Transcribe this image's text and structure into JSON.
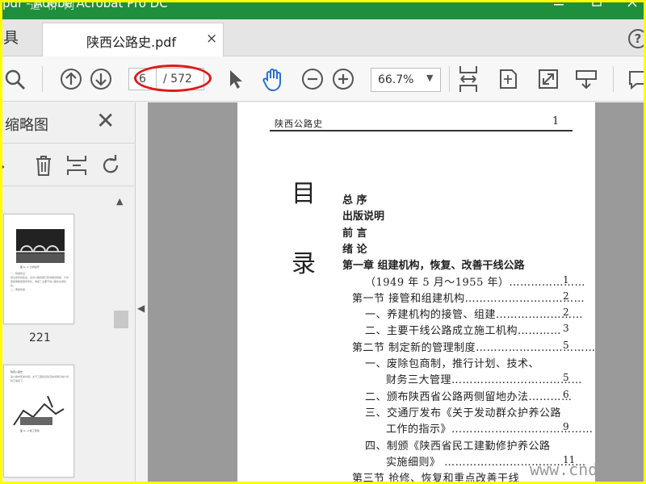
{
  "window": {
    "title": "pdf - Adobe Acrobat Pro DC",
    "watermark_top": "道 桥 网"
  },
  "tabs": {
    "tools_label": "具",
    "doc_name": "陕西公路史.pdf",
    "close": "×",
    "help": "?"
  },
  "toolbar": {
    "current_page": "6",
    "total_pages": "/ 572",
    "zoom": "66.7%",
    "zoom_arrow": "▼"
  },
  "panel": {
    "title": "缩略图",
    "close": "✕",
    "scroll_up": "▲",
    "thumb1_label": "221",
    "thumb1_caption": "图 6—1 大桥远景",
    "thumb1_body": "一、桥梁建设\n经过多年的建设，全省公路桥梁已形成相当规模，大中型桥梁数量逐年增长，承担了主要干线公路的交通任务。\n二、典型桥梁",
    "thumb2_heading": "陕西公路史",
    "thumb2_body": "第六章中所述内容，关于工程建设情况的说明与统计资料汇编如下。",
    "thumb2_caption": "图 6—2 施工现场"
  },
  "page": {
    "running_head": "陕西公路史",
    "page_number": "1",
    "big_chars": [
      "目",
      "录"
    ],
    "toc": [
      {
        "text": "总    序",
        "bold": true,
        "indent": 0,
        "num": ""
      },
      {
        "text": "出版说明",
        "bold": true,
        "indent": 0,
        "num": ""
      },
      {
        "text": "前    言",
        "bold": true,
        "indent": 0,
        "num": ""
      },
      {
        "text": "绪    论",
        "bold": true,
        "indent": 0,
        "num": ""
      },
      {
        "text": "第一章   组建机构，恢复、改善干线公路",
        "bold": true,
        "indent": 0,
        "num": ""
      },
      {
        "text": "（1949 年 5 月～1955 年）…………………",
        "bold": false,
        "indent": 28,
        "num": "1"
      },
      {
        "text": "第一节   接管和组建机构……………………………",
        "bold": false,
        "indent": 12,
        "num": "2"
      },
      {
        "text": "一、养建机构的接管、组建……………………",
        "bold": false,
        "indent": 28,
        "num": "2"
      },
      {
        "text": "二、主要干线公路成立施工机构…………",
        "bold": false,
        "indent": 28,
        "num": "3"
      },
      {
        "text": "第二节   制定新的管理制度……………………………",
        "bold": false,
        "indent": 12,
        "num": "5"
      },
      {
        "text": "一、废除包商制，推行计划、技术、",
        "bold": false,
        "indent": 28,
        "num": ""
      },
      {
        "text": "财务三大管理………………………………",
        "bold": false,
        "indent": 54,
        "num": "5"
      },
      {
        "text": "二、颁布陕西省公路两侧留地办法…………",
        "bold": false,
        "indent": 28,
        "num": "6"
      },
      {
        "text": "三、交通厅发布《关于发动群众护养公路",
        "bold": false,
        "indent": 28,
        "num": ""
      },
      {
        "text": "工作的指示》…………………………………",
        "bold": false,
        "indent": 54,
        "num": "9"
      },
      {
        "text": "四、制颁《陕西省民工建勤修护养公路",
        "bold": false,
        "indent": 28,
        "num": ""
      },
      {
        "text": "实施细则》  …………………………………",
        "bold": false,
        "indent": 54,
        "num": "11"
      },
      {
        "text": "第三节   抢修、恢复和重点改善干线",
        "bold": false,
        "indent": 12,
        "num": ""
      }
    ]
  },
  "watermark": "www.cndao"
}
